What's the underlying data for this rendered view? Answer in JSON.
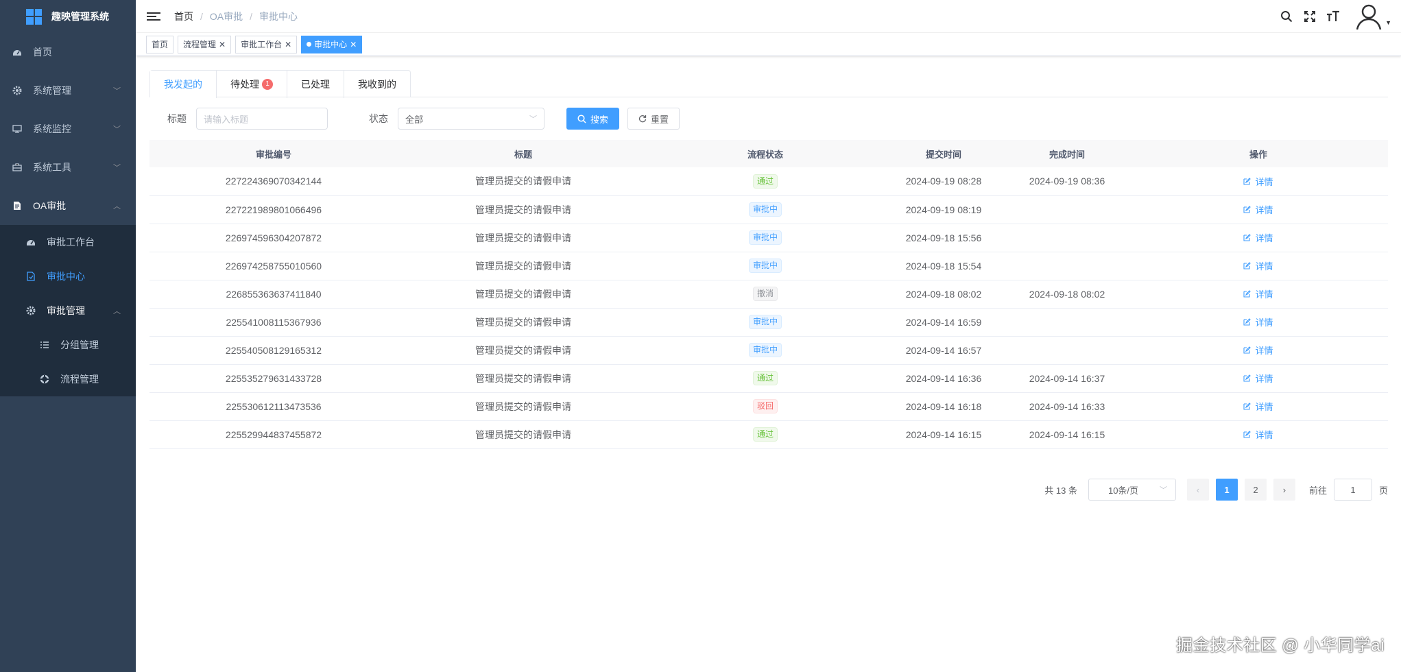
{
  "app": {
    "title": "趣映管理系统"
  },
  "sidebar": {
    "items": [
      {
        "label": "首页",
        "icon": "dashboard-icon"
      },
      {
        "label": "系统管理",
        "icon": "gear-icon"
      },
      {
        "label": "系统监控",
        "icon": "monitor-icon"
      },
      {
        "label": "系统工具",
        "icon": "toolbox-icon"
      },
      {
        "label": "OA审批",
        "icon": "document-icon"
      }
    ],
    "oa_children": [
      {
        "label": "审批工作台",
        "icon": "dashboard-icon"
      },
      {
        "label": "审批中心",
        "icon": "approval-icon"
      },
      {
        "label": "审批管理",
        "icon": "gear-icon"
      }
    ],
    "mgmt_children": [
      {
        "label": "分组管理",
        "icon": "list-icon"
      },
      {
        "label": "流程管理",
        "icon": "flow-icon"
      }
    ]
  },
  "breadcrumb": [
    "首页",
    "OA审批",
    "审批中心"
  ],
  "tags": [
    {
      "label": "首页"
    },
    {
      "label": "流程管理"
    },
    {
      "label": "审批工作台"
    },
    {
      "label": "审批中心"
    }
  ],
  "tabs": [
    {
      "label": "我发起的"
    },
    {
      "label": "待处理",
      "badge": "1"
    },
    {
      "label": "已处理"
    },
    {
      "label": "我收到的"
    }
  ],
  "search": {
    "title_label": "标题",
    "title_placeholder": "请输入标题",
    "status_label": "状态",
    "status_value": "全部",
    "search_btn": "搜索",
    "reset_btn": "重置"
  },
  "table": {
    "columns": [
      "审批编号",
      "标题",
      "流程状态",
      "提交时间",
      "完成时间",
      "操作"
    ],
    "detail_label": "详情",
    "rows": [
      {
        "id": "227224369070342144",
        "title": "管理员提交的请假申请",
        "status": "通过",
        "status_type": "pass",
        "submit": "2024-09-19 08:28",
        "finish": "2024-09-19 08:36"
      },
      {
        "id": "227221989801066496",
        "title": "管理员提交的请假申请",
        "status": "审批中",
        "status_type": "proc",
        "submit": "2024-09-19 08:19",
        "finish": ""
      },
      {
        "id": "226974596304207872",
        "title": "管理员提交的请假申请",
        "status": "审批中",
        "status_type": "proc",
        "submit": "2024-09-18 15:56",
        "finish": ""
      },
      {
        "id": "226974258755010560",
        "title": "管理员提交的请假申请",
        "status": "审批中",
        "status_type": "proc",
        "submit": "2024-09-18 15:54",
        "finish": ""
      },
      {
        "id": "226855363637411840",
        "title": "管理员提交的请假申请",
        "status": "撤消",
        "status_type": "cancel",
        "submit": "2024-09-18 08:02",
        "finish": "2024-09-18 08:02"
      },
      {
        "id": "225541008115367936",
        "title": "管理员提交的请假申请",
        "status": "审批中",
        "status_type": "proc",
        "submit": "2024-09-14 16:59",
        "finish": ""
      },
      {
        "id": "225540508129165312",
        "title": "管理员提交的请假申请",
        "status": "审批中",
        "status_type": "proc",
        "submit": "2024-09-14 16:57",
        "finish": ""
      },
      {
        "id": "225535279631433728",
        "title": "管理员提交的请假申请",
        "status": "通过",
        "status_type": "pass",
        "submit": "2024-09-14 16:36",
        "finish": "2024-09-14 16:37"
      },
      {
        "id": "225530612113473536",
        "title": "管理员提交的请假申请",
        "status": "驳回",
        "status_type": "reject",
        "submit": "2024-09-14 16:18",
        "finish": "2024-09-14 16:33"
      },
      {
        "id": "225529944837455872",
        "title": "管理员提交的请假申请",
        "status": "通过",
        "status_type": "pass",
        "submit": "2024-09-14 16:15",
        "finish": "2024-09-14 16:15"
      }
    ]
  },
  "pagination": {
    "total": "共 13 条",
    "page_size": "10条/页",
    "pages": [
      "1",
      "2"
    ],
    "current": "1",
    "goto_label": "前往",
    "goto_value": "1",
    "page_suffix": "页"
  },
  "watermark": "掘金技术社区 @ 小华同学ai"
}
